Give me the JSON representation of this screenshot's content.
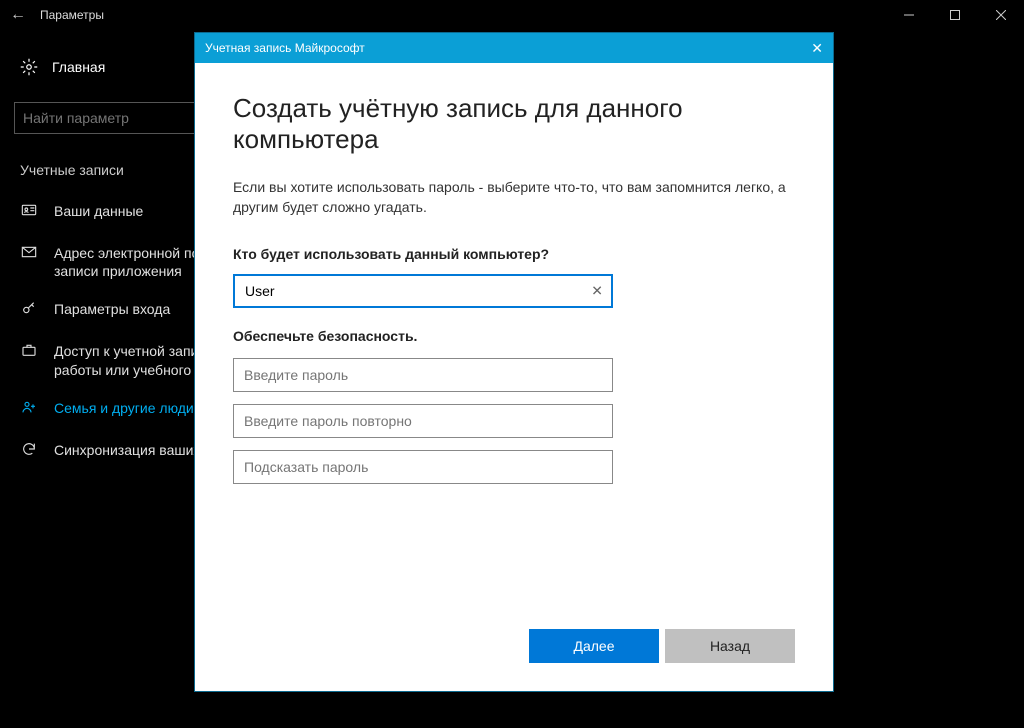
{
  "titlebar": {
    "title": "Параметры"
  },
  "sidebar": {
    "home_label": "Главная",
    "search_placeholder": "Найти параметр",
    "section_heading": "Учетные записи",
    "items": [
      {
        "label": "Ваши данные"
      },
      {
        "label": "Адрес электронной почты; учетные записи приложения"
      },
      {
        "label": "Параметры входа"
      },
      {
        "label": "Доступ к учетной записи места работы или учебного заведения"
      },
      {
        "label": "Семья и другие люди"
      },
      {
        "label": "Синхронизация ваших параметров"
      }
    ]
  },
  "modal": {
    "header_title": "Учетная запись Майкрософт",
    "page_title": "Создать учётную запись для данного компьютера",
    "description": "Если вы хотите использовать пароль - выберите что-то, что вам запомнится легко, а другим будет сложно угадать.",
    "who_label": "Кто будет использовать данный компьютер?",
    "username_value": "User",
    "security_label": "Обеспечьте безопасность.",
    "password_placeholder": "Введите пароль",
    "password_confirm_placeholder": "Введите пароль повторно",
    "password_hint_placeholder": "Подсказать пароль",
    "next_button": "Далее",
    "back_button": "Назад"
  }
}
